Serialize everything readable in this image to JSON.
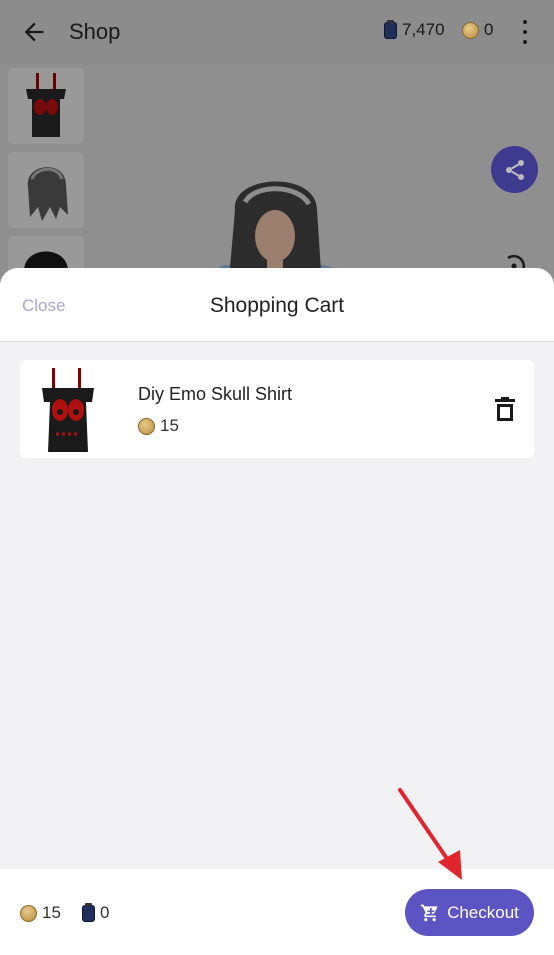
{
  "appbar": {
    "title": "Shop",
    "gems": "7,470",
    "coins": "0"
  },
  "cart": {
    "close_label": "Close",
    "title": "Shopping Cart",
    "items": [
      {
        "name": "Diy Emo Skull Shirt",
        "price": "15"
      }
    ]
  },
  "footer": {
    "total_coins": "15",
    "total_gems": "0",
    "checkout_label": "Checkout"
  },
  "colors": {
    "accent": "#5b54c2",
    "close_text": "#a9a6c9",
    "annotation_arrow": "#e0252d"
  },
  "icons": [
    "arrow-back-icon",
    "gem-jar-icon",
    "coin-icon",
    "more-vert-icon",
    "share-icon",
    "rotate-icon",
    "trash-icon",
    "cart-icon"
  ]
}
